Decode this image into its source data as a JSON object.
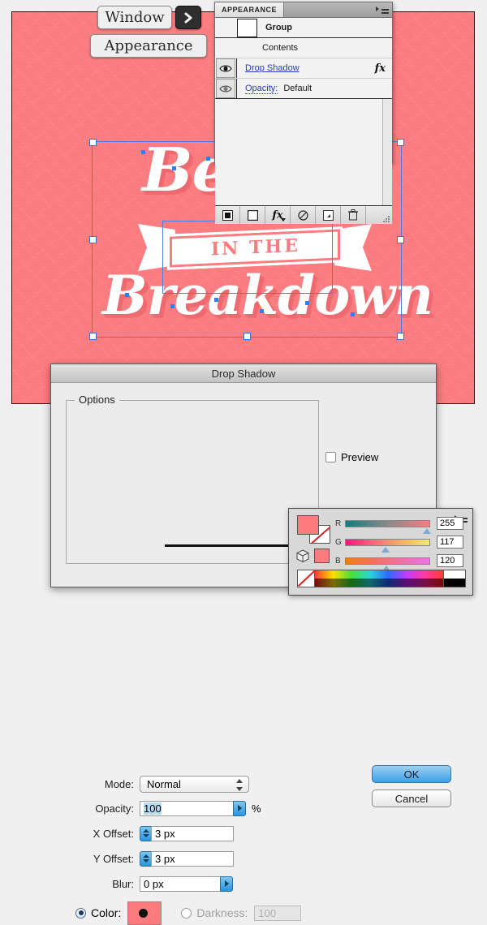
{
  "canvas": {
    "background_color": "#FC7B7F",
    "artwork": {
      "line1": "Beauty",
      "ribbon_text": "IN THE",
      "line2": "Breakdown"
    }
  },
  "callout_buttons": {
    "window": "Window",
    "appearance": "Appearance",
    "arrow_icon": "chevron-right-icon"
  },
  "appearance_panel": {
    "tab_label": "APPEARANCE",
    "menu_icon": "panel-menu-icon",
    "rows": [
      {
        "label": "Group",
        "style": "bold",
        "has_swatch": true,
        "has_eye": false
      },
      {
        "label": "Contents",
        "style": "plain",
        "has_swatch": false,
        "has_eye": false
      },
      {
        "label": "Drop Shadow",
        "style": "link",
        "has_eye": true,
        "fx": "fx"
      },
      {
        "label": "Opacity:",
        "value": "Default",
        "style": "link-dotted",
        "has_eye": true
      }
    ],
    "footer_icons": [
      "add-new-fill-icon",
      "add-new-stroke-icon",
      "add-new-effect-icon",
      "clear-appearance-icon",
      "duplicate-item-icon",
      "delete-item-icon",
      "resize-grip-icon"
    ]
  },
  "dialog": {
    "title": "Drop Shadow",
    "options_legend": "Options",
    "fields": {
      "mode_label": "Mode:",
      "mode_value": "Normal",
      "opacity_label": "Opacity:",
      "opacity_value": "100",
      "opacity_unit": "%",
      "x_offset_label": "X Offset:",
      "x_offset_value": "3 px",
      "y_offset_label": "Y Offset:",
      "y_offset_value": "3 px",
      "blur_label": "Blur:",
      "blur_value": "0 px",
      "color_label": "Color:",
      "color_value": "#FC7B7F",
      "darkness_label": "Darkness:",
      "darkness_value": "100"
    },
    "buttons": {
      "ok": "OK",
      "cancel": "Cancel",
      "preview": "Preview"
    }
  },
  "color_panel": {
    "menu_icon": "panel-menu-icon",
    "fill_color": "#FC7B7F",
    "stroke_color": "none",
    "channels": [
      {
        "name": "R",
        "value": "255",
        "thumb_pct": 99
      },
      {
        "name": "G",
        "value": "117",
        "thumb_pct": 46
      },
      {
        "name": "B",
        "value": "120",
        "thumb_pct": 47
      }
    ]
  }
}
